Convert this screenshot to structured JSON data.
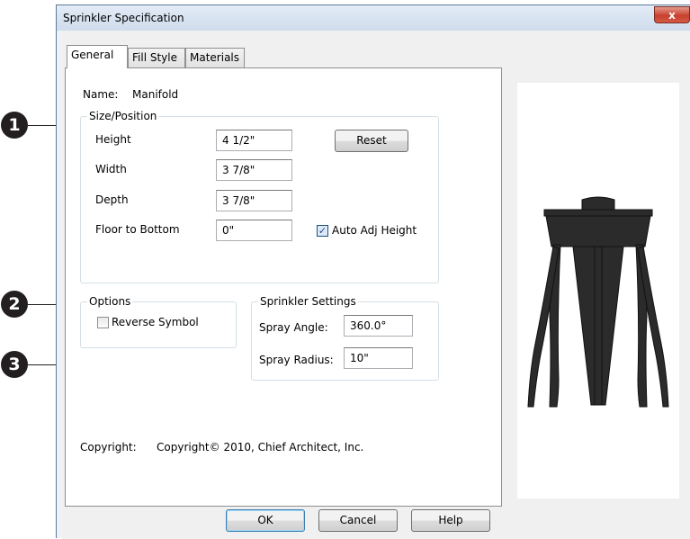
{
  "dialog": {
    "title": "Sprinkler Specification",
    "close_glyph": "x",
    "tabs": [
      {
        "label": "General",
        "active": true
      },
      {
        "label": "Fill Style",
        "active": false
      },
      {
        "label": "Materials",
        "active": false
      }
    ],
    "name_label": "Name:",
    "name_value": "Manifold",
    "size_position": {
      "legend": "Size/Position",
      "height_label": "Height",
      "height_value": "4 1/2\"",
      "width_label": "Width",
      "width_value": "3 7/8\"",
      "depth_label": "Depth",
      "depth_value": "3 7/8\"",
      "floor_label": "Floor to Bottom",
      "floor_value": "0\"",
      "reset_label": "Reset",
      "auto_adj_label": "Auto Adj Height",
      "auto_adj_checked": true
    },
    "options": {
      "legend": "Options",
      "reverse_label": "Reverse Symbol",
      "reverse_checked": false
    },
    "sprinkler_settings": {
      "legend": "Sprinkler Settings",
      "spray_angle_label": "Spray Angle:",
      "spray_angle_value": "360.0°",
      "spray_radius_label": "Spray Radius:",
      "spray_radius_value": "10\""
    },
    "copyright_label": "Copyright:",
    "copyright_value": "Copyright© 2010, Chief Architect, Inc.",
    "buttons": {
      "ok": "OK",
      "cancel": "Cancel",
      "help": "Help"
    }
  },
  "callouts": [
    "1",
    "2",
    "3"
  ],
  "colors": {
    "callout": "#231f20",
    "preview_object": "#2b2b2b"
  }
}
